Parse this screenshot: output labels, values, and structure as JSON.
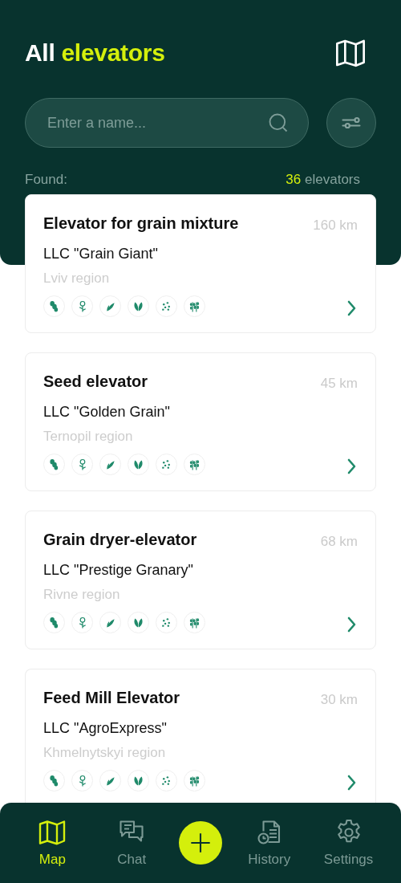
{
  "header": {
    "title": {
      "lead": "All",
      "accent": "elevators"
    }
  },
  "search": {
    "placeholder": "Enter a name..."
  },
  "found": {
    "label": "Found:",
    "count": "36",
    "unit": "elevators"
  },
  "elevators": [
    {
      "name": "Elevator for grain mixture",
      "company": "LLC \"Grain Giant\"",
      "region": "Lviv region",
      "distance": "160 km"
    },
    {
      "name": "Seed elevator",
      "company": "LLC \"Golden Grain\"",
      "region": "Ternopil region",
      "distance": "45 km"
    },
    {
      "name": "Grain dryer-elevator",
      "company": "LLC \"Prestige Granary\"",
      "region": "Rivne region",
      "distance": "68 km"
    },
    {
      "name": "Feed Mill Elevator",
      "company": "LLC \"AgroExpress\"",
      "region": "Khmelnytskyi region",
      "distance": "30 km"
    }
  ],
  "nav": [
    {
      "kind": "tab",
      "label": "Map",
      "selected": true
    },
    {
      "kind": "tab",
      "label": "Chat",
      "selected": false
    },
    {
      "kind": "add"
    },
    {
      "kind": "tab",
      "label": "History",
      "selected": false
    },
    {
      "kind": "tab",
      "label": "Settings",
      "selected": false
    }
  ]
}
